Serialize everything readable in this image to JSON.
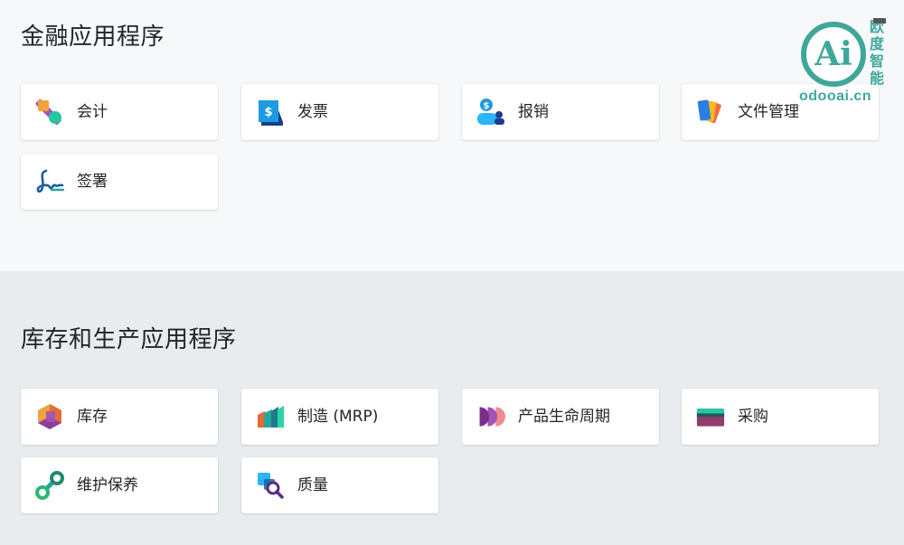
{
  "finance": {
    "title": "金融应用程序",
    "apps": [
      {
        "label": "会计",
        "icon": "accounting-icon"
      },
      {
        "label": "发票",
        "icon": "invoicing-icon"
      },
      {
        "label": "报销",
        "icon": "expenses-icon"
      },
      {
        "label": "文件管理",
        "icon": "documents-icon"
      },
      {
        "label": "签署",
        "icon": "sign-icon"
      }
    ]
  },
  "inventory": {
    "title": "库存和生产应用程序",
    "apps": [
      {
        "label": "库存",
        "icon": "inventory-icon"
      },
      {
        "label": "制造 (MRP)",
        "icon": "manufacturing-icon"
      },
      {
        "label": "产品生命周期",
        "icon": "plm-icon"
      },
      {
        "label": "采购",
        "icon": "purchase-icon"
      },
      {
        "label": "维护保养",
        "icon": "maintenance-icon"
      },
      {
        "label": "质量",
        "icon": "quality-icon"
      }
    ]
  },
  "watermark": {
    "logo_text": "Ai",
    "brand_cn": "欧度智能",
    "url": "odooai.cn"
  },
  "colors": {
    "finance_bg": "#f7f8fa",
    "inventory_bg": "#e9ecef",
    "watermark": "#3fa79a"
  }
}
